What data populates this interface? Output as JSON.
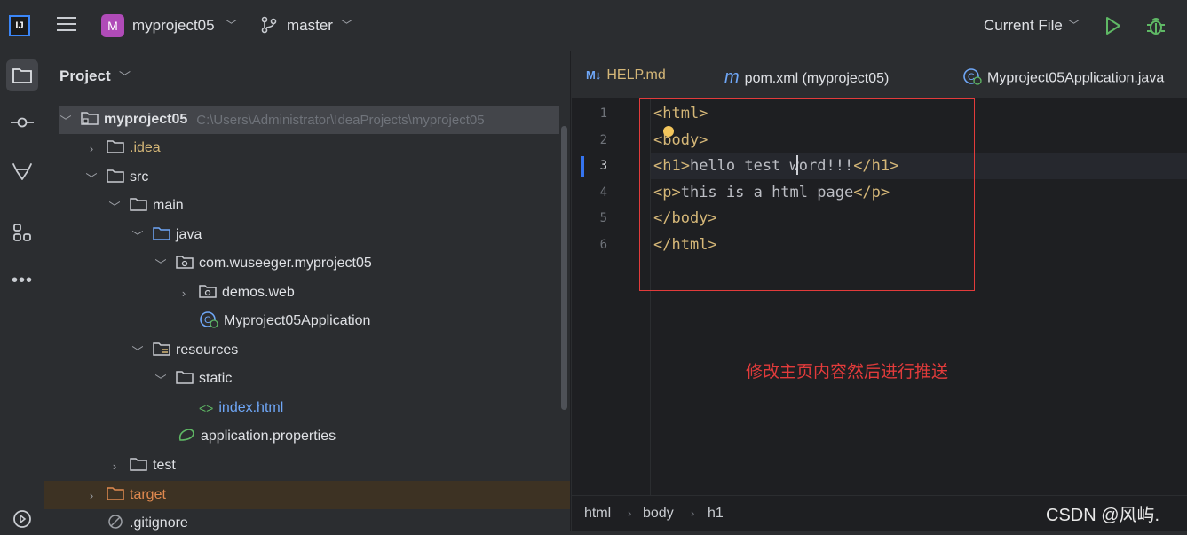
{
  "toolbar": {
    "logo": "IJ",
    "project_badge": "M",
    "project_name": "myproject05",
    "branch": "master",
    "run_config": "Current File"
  },
  "project_panel": {
    "title": "Project",
    "tree": [
      {
        "label": "myproject05",
        "path": "C:\\Users\\Administrator\\IdeaProjects\\myproject05"
      },
      {
        "label": ".idea"
      },
      {
        "label": "src"
      },
      {
        "label": "main"
      },
      {
        "label": "java"
      },
      {
        "label": "com.wuseeger.myproject05"
      },
      {
        "label": "demos.web"
      },
      {
        "label": "Myproject05Application"
      },
      {
        "label": "resources"
      },
      {
        "label": "static"
      },
      {
        "label": "index.html"
      },
      {
        "label": "application.properties"
      },
      {
        "label": "test"
      },
      {
        "label": "target"
      },
      {
        "label": ".gitignore"
      }
    ]
  },
  "editor": {
    "tabs": [
      {
        "badge": "M↓",
        "label": "HELP.md"
      },
      {
        "badge": "m",
        "label": "pom.xml (myproject05)"
      },
      {
        "label": "Myproject05Application.java"
      }
    ],
    "line_numbers": [
      "1",
      "2",
      "3",
      "4",
      "5",
      "6"
    ],
    "lines": [
      {
        "t1": "<html>"
      },
      {
        "t1": "<body>"
      },
      {
        "t1": "<h1>",
        "text": "hello test word!!!",
        "t2": "</h1>"
      },
      {
        "t1": "<p>",
        "text": "this is a html page",
        "t2": "</p>"
      },
      {
        "t1": "</body>"
      },
      {
        "t1": "</html>"
      }
    ],
    "annotation": "修改主页内容然后进行推送",
    "breadcrumb": [
      "html",
      "body",
      "h1"
    ]
  },
  "watermark": "CSDN @风屿."
}
